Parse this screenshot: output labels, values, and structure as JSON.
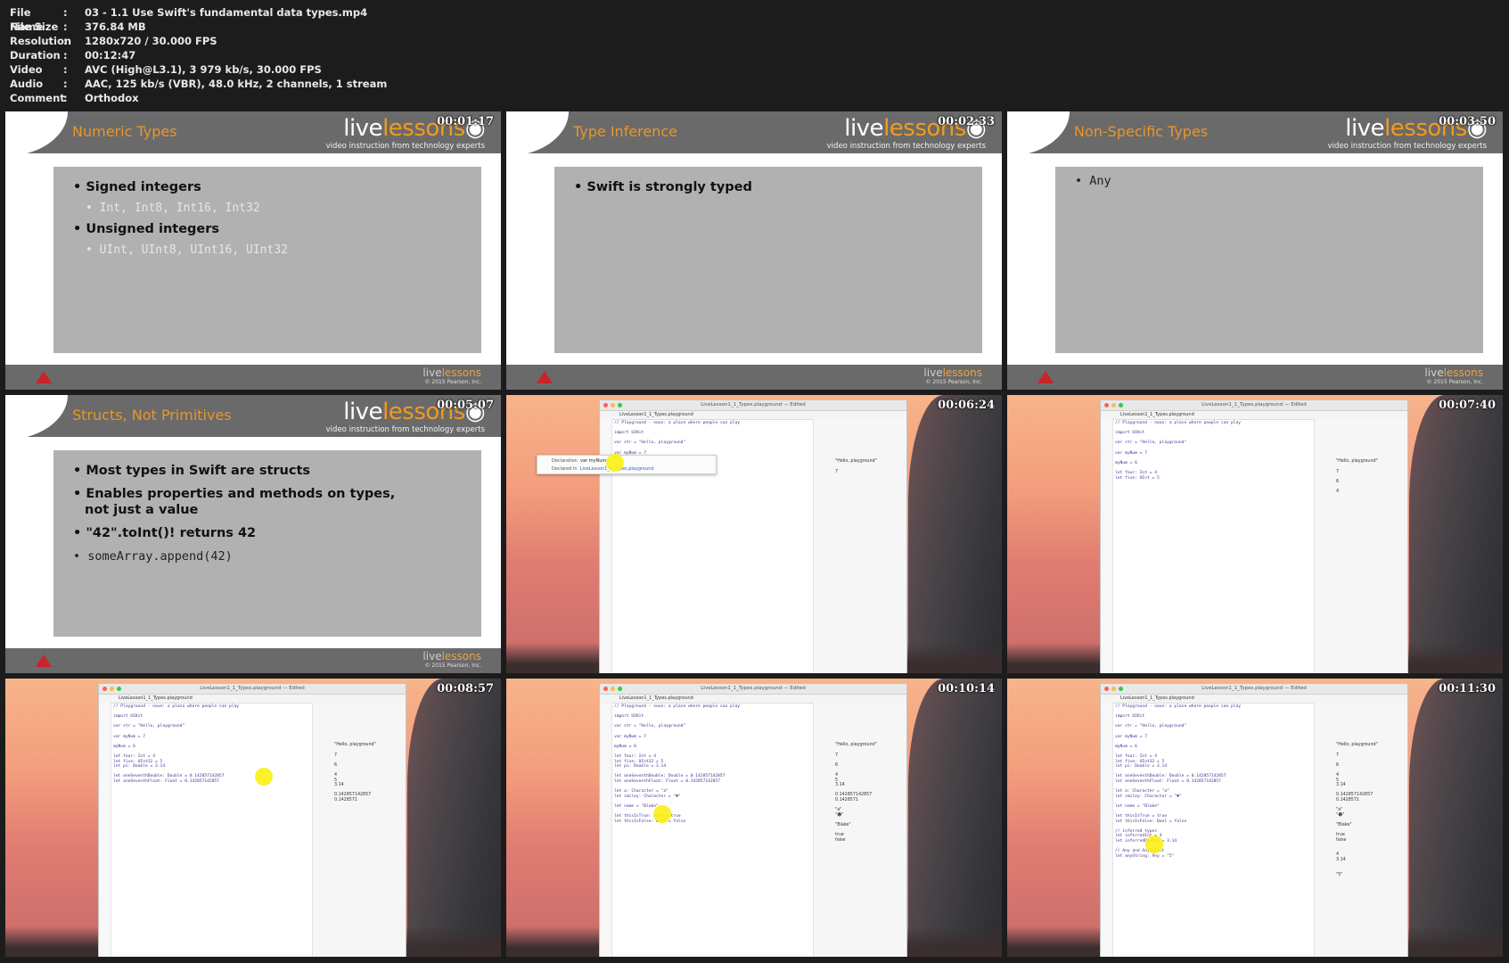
{
  "file_info": {
    "rows": [
      {
        "key": "File Name",
        "value": "03 - 1.1 Use Swift's fundamental data types.mp4"
      },
      {
        "key": "File Size",
        "value": "376.84 MB"
      },
      {
        "key": "Resolution",
        "value": "1280x720 / 30.000 FPS"
      },
      {
        "key": "Duration",
        "value": "00:12:47"
      },
      {
        "key": "Video",
        "value": "AVC (High@L3.1), 3 979 kb/s, 30.000 FPS"
      },
      {
        "key": "Audio",
        "value": "AAC, 125 kb/s (VBR), 48.0 kHz, 2 channels, 1 stream"
      },
      {
        "key": "Comment",
        "value": "Orthodox"
      }
    ],
    "separator": ":"
  },
  "brand": {
    "word_live": "live",
    "word_lessons": "lessons",
    "play_glyph": "◉",
    "tagline": "video instruction from technology experts",
    "copyright": "© 2015 Pearson, Inc."
  },
  "thumbs": [
    {
      "timestamp": "00:01:17",
      "title": "Numeric Types",
      "bullets": [
        {
          "text": "• Signed integers"
        },
        {
          "text": "• Int, Int8, Int16, Int32"
        },
        {
          "text": "• Unsigned integers"
        },
        {
          "text": "• UInt, UInt8, UInt16, UInt32"
        }
      ]
    },
    {
      "timestamp": "00:02:33",
      "title": "Type Inference",
      "bullets": [
        {
          "text": "• Swift is strongly typed"
        }
      ]
    },
    {
      "timestamp": "00:03:50",
      "title": "Non-Specific Types",
      "bullets": [
        {
          "text": "• Any"
        }
      ]
    },
    {
      "timestamp": "00:05:07",
      "title": "Structs, Not Primitives",
      "bullets": [
        {
          "text": "• Most types in Swift are structs"
        },
        {
          "text": "• Enables properties and methods on types,"
        },
        {
          "text": "not just a value"
        },
        {
          "text": "• \"42\".toInt()! returns 42"
        },
        {
          "text": "• someArray.append(42)"
        }
      ]
    },
    {
      "timestamp": "00:06:24",
      "window_title": "LiveLesson1_1_Types.playground — Edited",
      "tab": "LiveLesson1_1_Types.playground",
      "code": "// Playground - noun: a place where people can play\n\nimport UIKit\n\nvar str = \"Hello, playground\"\n\nvar myNum = 7",
      "results": "\n\n\n\n\"Hello, playground\"\n\n7",
      "popover": {
        "decl_label": "Declaration",
        "decl_value": "var myNum",
        "file_label": "Declared In",
        "file_value": "LiveLesson1_1_Types.playground"
      }
    },
    {
      "timestamp": "00:07:40",
      "window_title": "LiveLesson1_1_Types.playground — Edited",
      "tab": "LiveLesson1_1_Types.playground",
      "code": "// Playground - noun: a place where people can play\n\nimport UIKit\n\nvar str = \"Hello, playground\"\n\nvar myNum = 7\n\nmyNum = 6\n\nlet four: Int = 4\nlet five: UInt = 5",
      "results": "\n\n\n\n\"Hello, playground\"\n\n7\n\n6\n\n4"
    },
    {
      "timestamp": "00:08:57",
      "window_title": "LiveLesson1_1_Types.playground — Edited",
      "tab": "LiveLesson1_1_Types.playground",
      "code": "// Playground - noun: a place where people can play\n\nimport UIKit\n\nvar str = \"Hello, playground\"\n\nvar myNum = 7\n\nmyNum = 6\n\nlet four: Int = 4\nlet five: UInt32 = 5\nlet pi: Double = 3.14\n\nlet oneSeventhDouble: Double = 0.142857142857\nlet oneSeventhFloat: Float = 0.142857142857",
      "results": "\n\n\n\n\"Hello, playground\"\n\n7\n\n6\n\n4\n5\n3.14\n\n0.142857142857\n0.1428571"
    },
    {
      "timestamp": "00:10:14",
      "window_title": "LiveLesson1_1_Types.playground — Edited",
      "tab": "LiveLesson1_1_Types.playground",
      "code": "// Playground - noun: a place where people can play\n\nimport UIKit\n\nvar str = \"Hello, playground\"\n\nvar myNum = 7\n\nmyNum = 6\n\nlet four: Int = 4\nlet five: UInt32 = 5\nlet pi: Double = 3.14\n\nlet oneSeventhDouble: Double = 0.142857142857\nlet oneSeventhFloat: Float = 0.142857142857\n\nlet a: Character = \"a\"\nlet smiley: Character = \"☻\"\n\nlet name = \"Blake\"\n\nlet thisIsTrue: Bool = true\nlet thisIsFalse: Bool = false",
      "results": "\n\n\n\n\"Hello, playground\"\n\n7\n\n6\n\n4\n5\n3.14\n\n0.142857142857\n0.1428571\n\n\"a\"\n\"☻\"\n\n\"Blake\"\n\ntrue\nfalse"
    },
    {
      "timestamp": "00:11:30",
      "window_title": "LiveLesson1_1_Types.playground — Edited",
      "tab": "LiveLesson1_1_Types.playground",
      "code": "// Playground - noun: a place where people can play\n\nimport UIKit\n\nvar str = \"Hello, playground\"\n\nvar myNum = 7\n\nmyNum = 6\n\nlet four: Int = 4\nlet five: UInt32 = 5\nlet pi: Double = 3.14\n\nlet oneSeventhDouble: Double = 0.142857142857\nlet oneSeventhFloat: Float = 0.142857142857\n\nlet a: Character = \"a\"\nlet smiley: Character = \"☻\"\n\nlet name = \"Blake\"\n\nlet thisIsTrue = true\nlet thisIsFalse: Bool = false\n\n// inferred types\nlet inferredInt = 4\nlet inferredDouble = 3.14\n\n// Any and AnyObject\nlet anyString: Any = \"5\"",
      "results": "\n\n\n\n\"Hello, playground\"\n\n7\n\n6\n\n4\n5\n3.14\n\n0.142857142857\n0.1428571\n\n\"a\"\n\"☻\"\n\n\"Blake\"\n\ntrue\nfalse\n\n\n4\n3.14\n\n\n\"5\""
    }
  ],
  "colors": {
    "accent_orange": "#f19a1e",
    "slide_gray": "#6a6a6a",
    "content_gray": "#b1b1b1",
    "pearson_red": "#c8242b",
    "cursor_yellow": "#faf014"
  }
}
